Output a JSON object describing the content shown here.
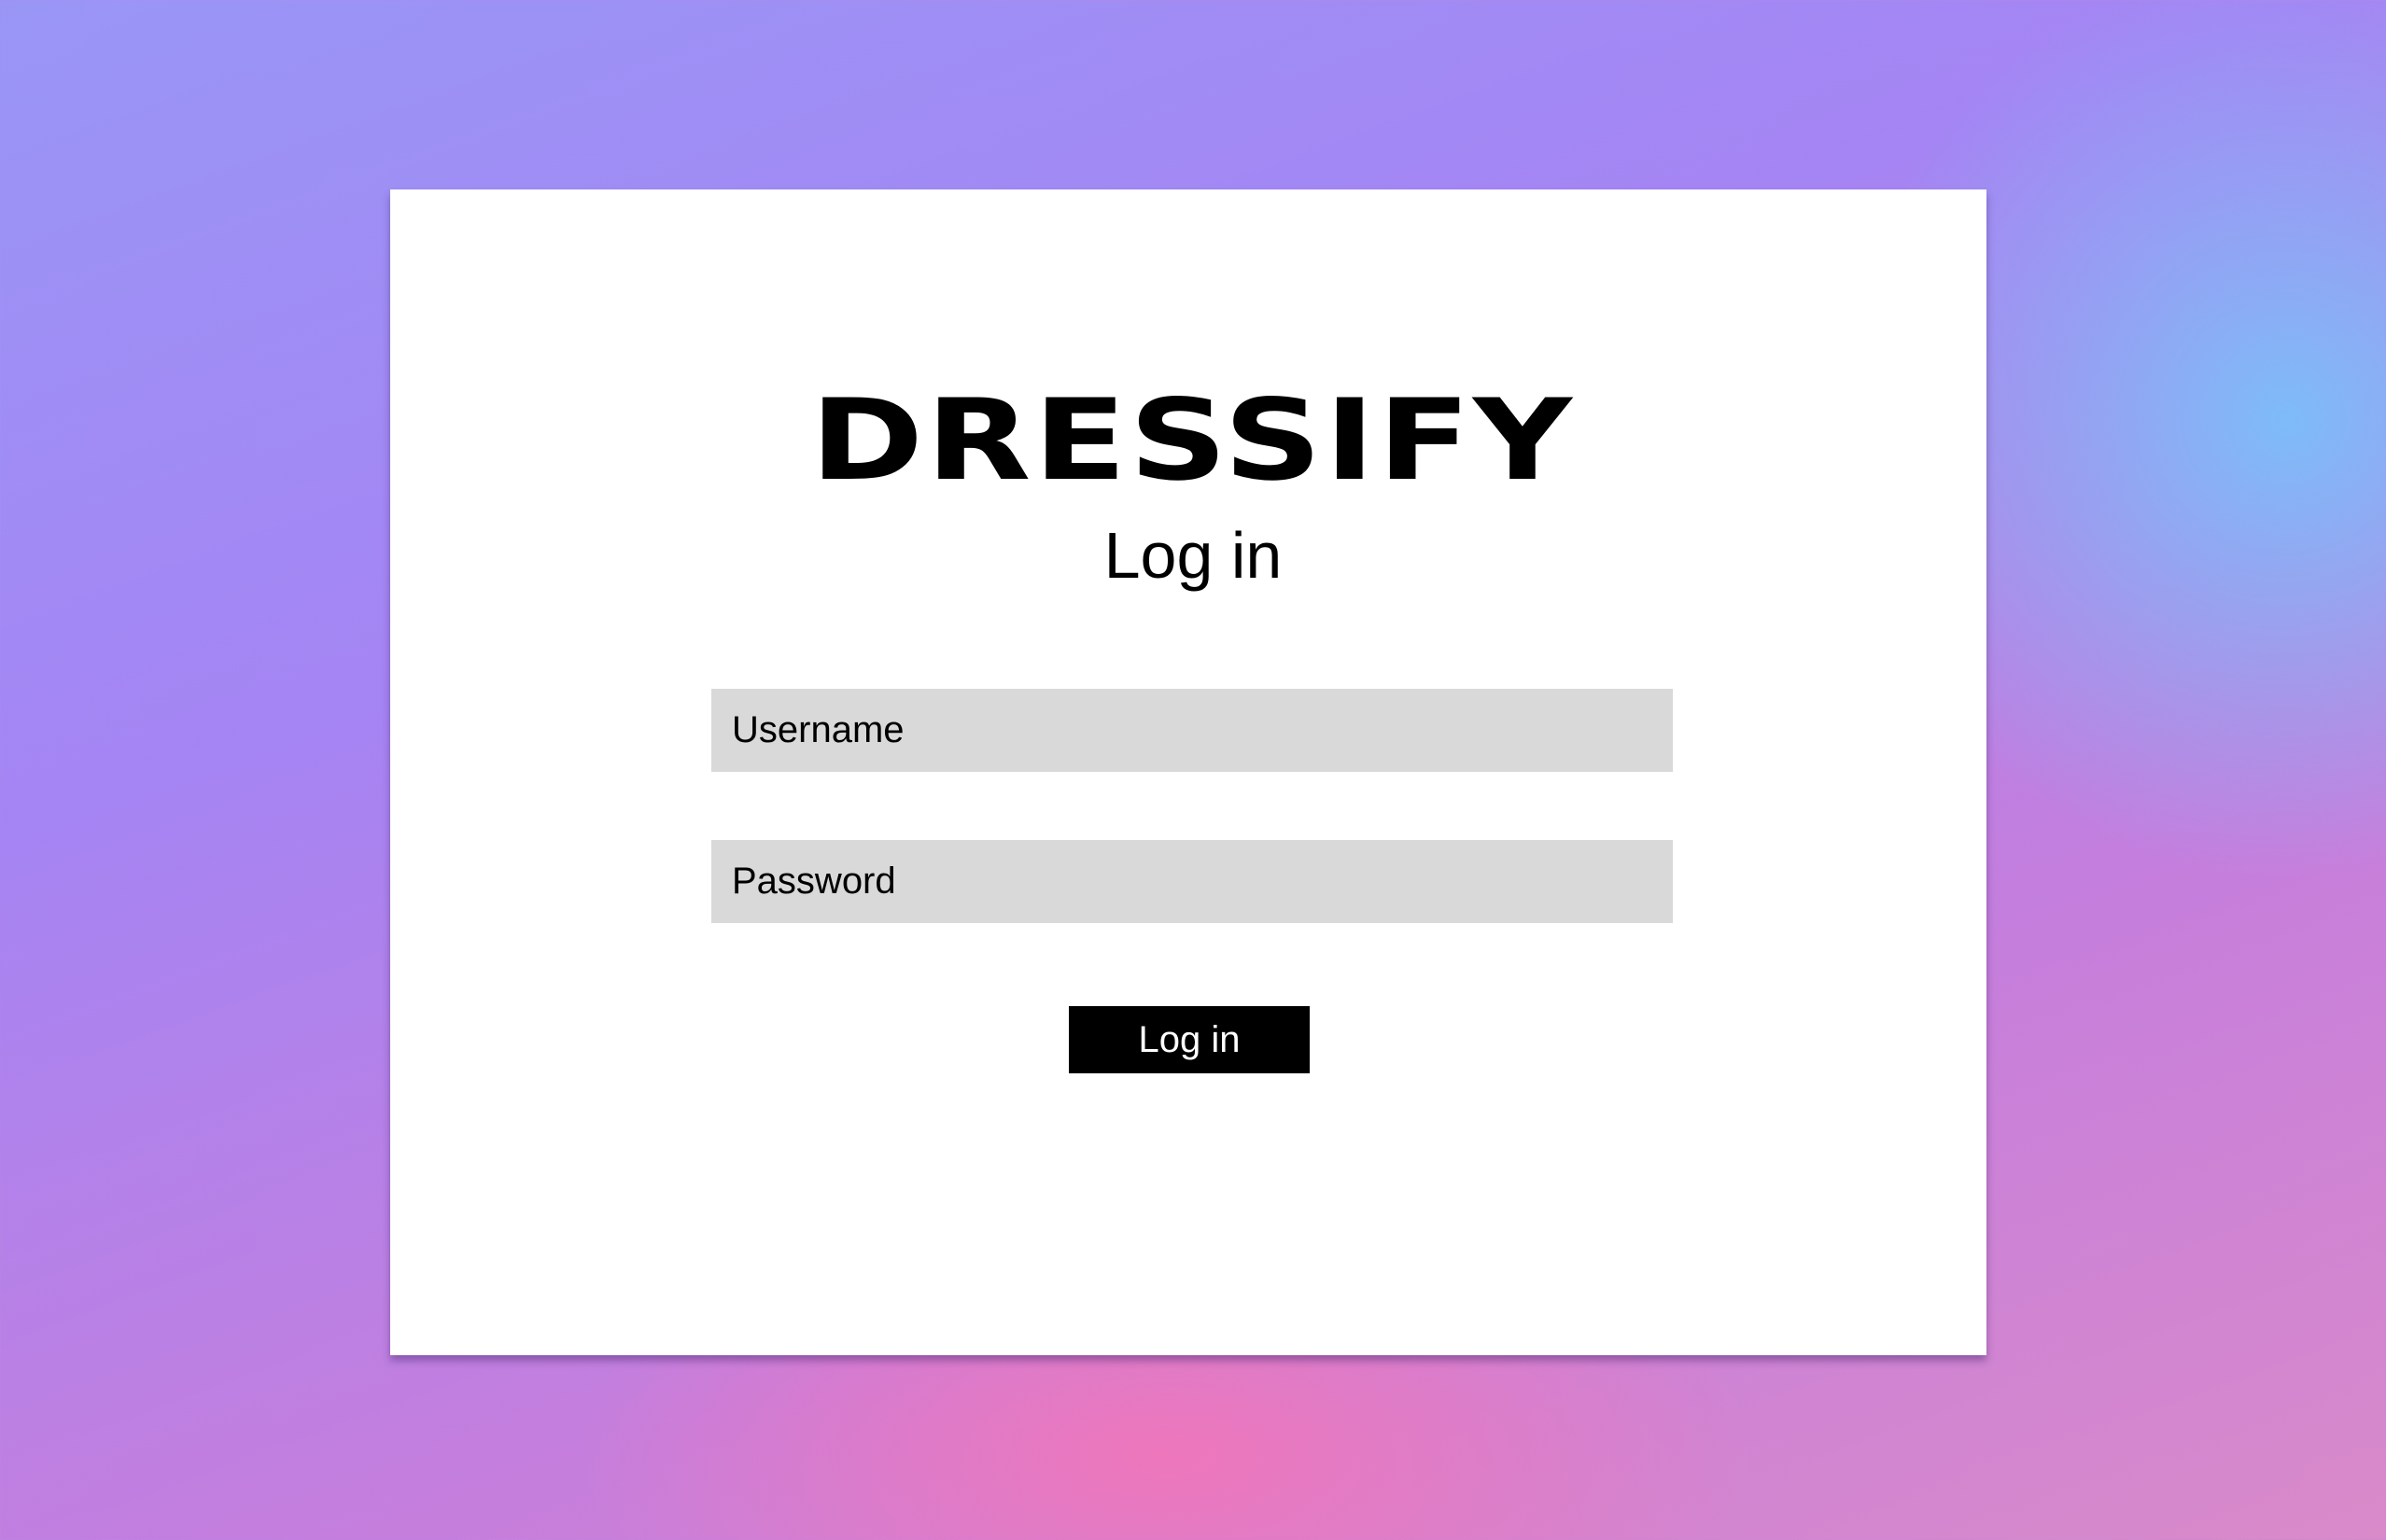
{
  "brand": {
    "logo_text": "DRESSIFY"
  },
  "form": {
    "heading": "Log in",
    "username_placeholder": "Username",
    "password_placeholder": "Password",
    "submit_label": "Log in"
  },
  "colors": {
    "card_background": "#ffffff",
    "input_background": "#d9d9d9",
    "button_background": "#000000",
    "button_text": "#ffffff"
  }
}
